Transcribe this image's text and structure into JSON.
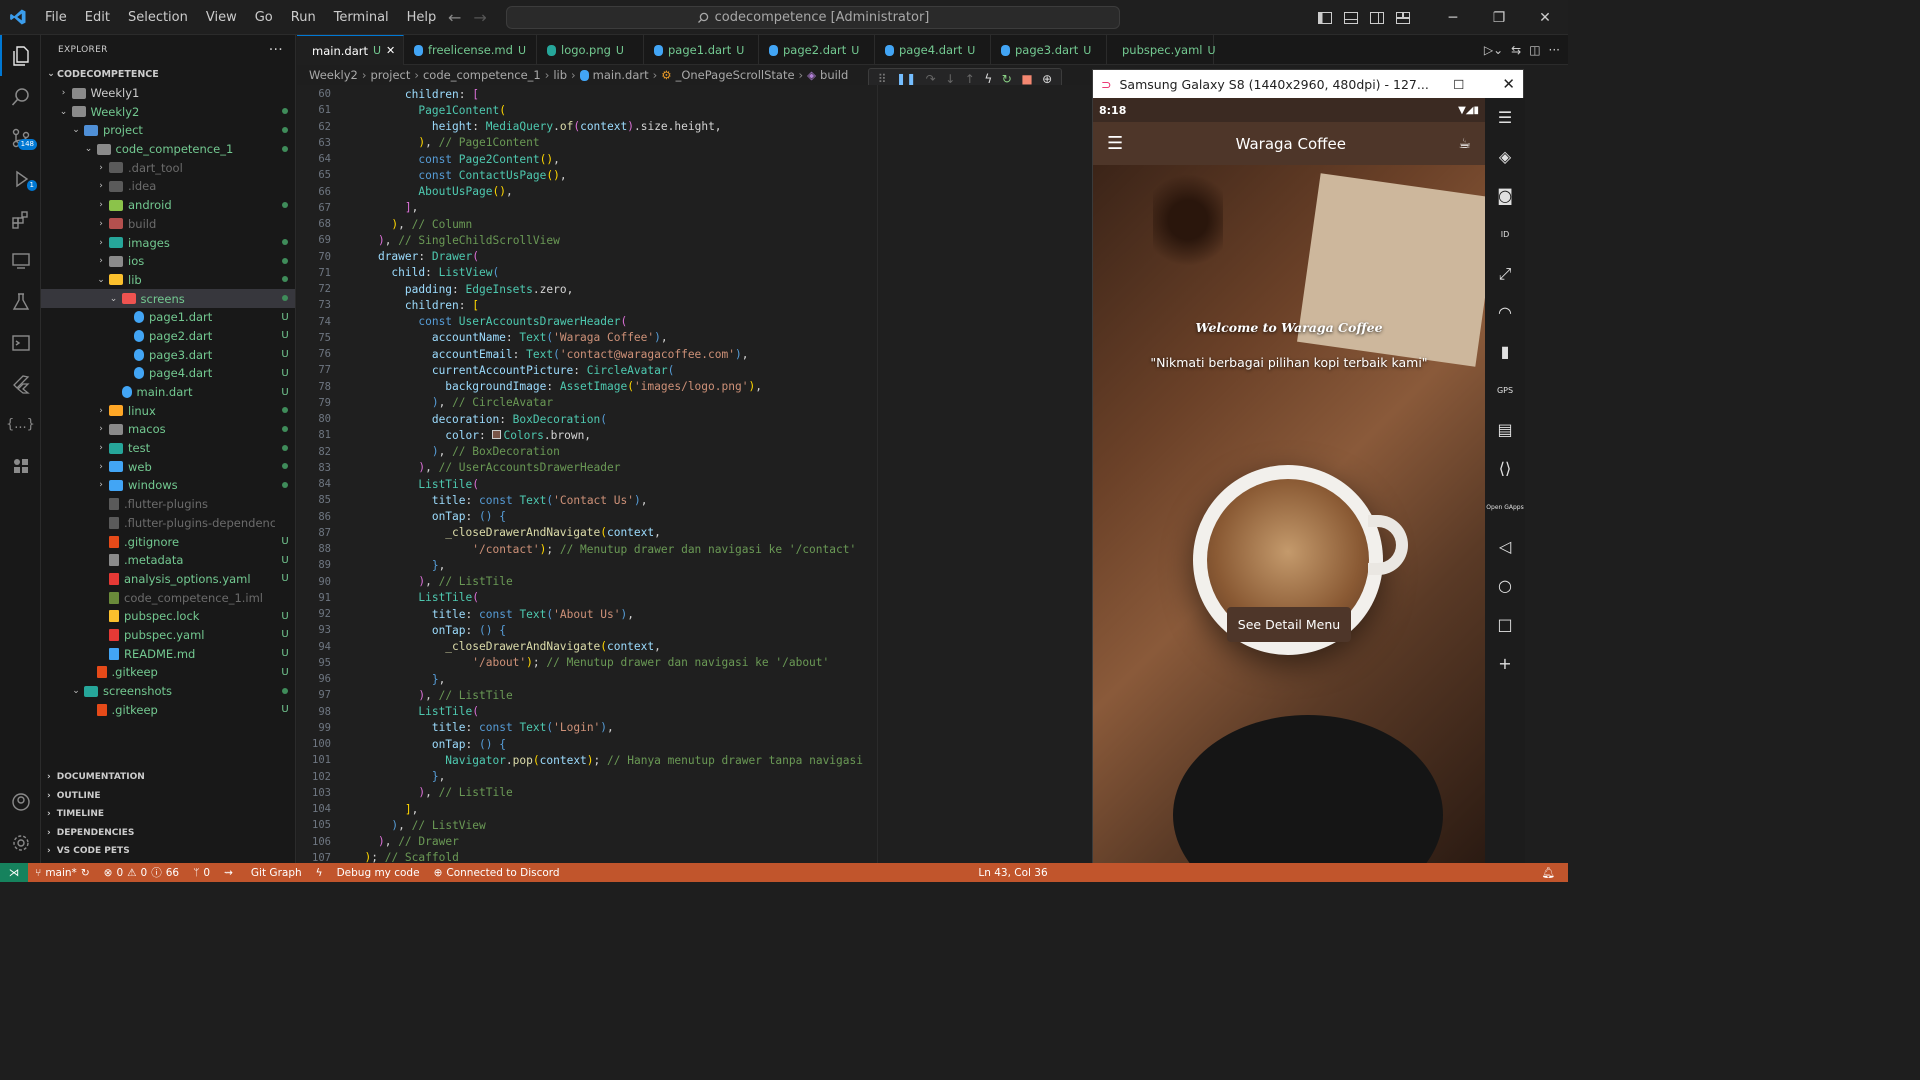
{
  "menu": [
    "File",
    "Edit",
    "Selection",
    "View",
    "Go",
    "Run",
    "Terminal",
    "Help"
  ],
  "command_center": "codecompetence [Administrator]",
  "explorer": {
    "title": "EXPLORER",
    "root": "CODECOMPETENCE",
    "items": [
      {
        "label": "Weekly1",
        "depth": 1,
        "kind": "folder",
        "open": false,
        "status": "",
        "dim": false,
        "color": "#8a8a8a"
      },
      {
        "label": "Weekly2",
        "depth": 1,
        "kind": "folder",
        "open": true,
        "status": "dot",
        "dim": false,
        "color": "#8a8a8a"
      },
      {
        "label": "project",
        "depth": 2,
        "kind": "folder",
        "open": true,
        "status": "dot",
        "dim": false,
        "color": "#4f8fd6"
      },
      {
        "label": "code_competence_1",
        "depth": 3,
        "kind": "folder",
        "open": true,
        "status": "dot",
        "dim": false,
        "color": "#8a8a8a"
      },
      {
        "label": ".dart_tool",
        "depth": 4,
        "kind": "folder",
        "open": false,
        "status": "",
        "dim": true,
        "color": "#5a5a5a"
      },
      {
        "label": ".idea",
        "depth": 4,
        "kind": "folder",
        "open": false,
        "status": "",
        "dim": true,
        "color": "#5a5a5a"
      },
      {
        "label": "android",
        "depth": 4,
        "kind": "folder",
        "open": false,
        "status": "dot",
        "dim": false,
        "color": "#8bc34a"
      },
      {
        "label": "build",
        "depth": 4,
        "kind": "folder",
        "open": false,
        "status": "",
        "dim": true,
        "color": "#b4504e"
      },
      {
        "label": "images",
        "depth": 4,
        "kind": "folder",
        "open": false,
        "status": "dot",
        "dim": false,
        "color": "#26a69a"
      },
      {
        "label": "ios",
        "depth": 4,
        "kind": "folder",
        "open": false,
        "status": "dot",
        "dim": false,
        "color": "#8a8a8a"
      },
      {
        "label": "lib",
        "depth": 4,
        "kind": "folder",
        "open": true,
        "status": "dot",
        "dim": false,
        "color": "#fbc02d"
      },
      {
        "label": "screens",
        "depth": 5,
        "kind": "folder",
        "open": true,
        "status": "dot",
        "dim": false,
        "color": "#ef5350",
        "selected": true
      },
      {
        "label": "page1.dart",
        "depth": 6,
        "kind": "dart",
        "status": "U",
        "dim": false,
        "color": "#42a5f5"
      },
      {
        "label": "page2.dart",
        "depth": 6,
        "kind": "dart",
        "status": "U",
        "dim": false,
        "color": "#42a5f5"
      },
      {
        "label": "page3.dart",
        "depth": 6,
        "kind": "dart",
        "status": "U",
        "dim": false,
        "color": "#42a5f5"
      },
      {
        "label": "page4.dart",
        "depth": 6,
        "kind": "dart",
        "status": "U",
        "dim": false,
        "color": "#42a5f5"
      },
      {
        "label": "main.dart",
        "depth": 5,
        "kind": "dart",
        "status": "U",
        "dim": false,
        "color": "#42a5f5"
      },
      {
        "label": "linux",
        "depth": 4,
        "kind": "folder",
        "open": false,
        "status": "dot",
        "dim": false,
        "color": "#ffa726"
      },
      {
        "label": "macos",
        "depth": 4,
        "kind": "folder",
        "open": false,
        "status": "dot",
        "dim": false,
        "color": "#8a8a8a"
      },
      {
        "label": "test",
        "depth": 4,
        "kind": "folder",
        "open": false,
        "status": "dot",
        "dim": false,
        "color": "#26a69a"
      },
      {
        "label": "web",
        "depth": 4,
        "kind": "folder",
        "open": false,
        "status": "dot",
        "dim": false,
        "color": "#42a5f5"
      },
      {
        "label": "windows",
        "depth": 4,
        "kind": "folder",
        "open": false,
        "status": "dot",
        "dim": false,
        "color": "#42a5f5"
      },
      {
        "label": ".flutter-plugins",
        "depth": 4,
        "kind": "file",
        "status": "",
        "dim": true,
        "color": "#5a5a5a"
      },
      {
        "label": ".flutter-plugins-dependencies",
        "depth": 4,
        "kind": "file",
        "status": "",
        "dim": true,
        "color": "#5a5a5a"
      },
      {
        "label": ".gitignore",
        "depth": 4,
        "kind": "git",
        "status": "U",
        "dim": false,
        "color": "#e64a19"
      },
      {
        "label": ".metadata",
        "depth": 4,
        "kind": "file",
        "status": "U",
        "dim": false,
        "color": "#8a8a8a"
      },
      {
        "label": "analysis_options.yaml",
        "depth": 4,
        "kind": "yaml",
        "status": "U",
        "dim": false,
        "color": "#e53935"
      },
      {
        "label": "code_competence_1.iml",
        "depth": 4,
        "kind": "file",
        "status": "",
        "dim": true,
        "color": "#6a8a3a"
      },
      {
        "label": "pubspec.lock",
        "depth": 4,
        "kind": "lock",
        "status": "U",
        "dim": false,
        "color": "#fbc02d"
      },
      {
        "label": "pubspec.yaml",
        "depth": 4,
        "kind": "yaml",
        "status": "U",
        "dim": false,
        "color": "#e53935"
      },
      {
        "label": "README.md",
        "depth": 4,
        "kind": "info",
        "status": "U",
        "dim": false,
        "color": "#42a5f5"
      },
      {
        "label": ".gitkeep",
        "depth": 3,
        "kind": "git",
        "status": "U",
        "dim": false,
        "color": "#e64a19"
      },
      {
        "label": "screenshots",
        "depth": 2,
        "kind": "folder",
        "open": true,
        "status": "dot",
        "dim": false,
        "color": "#26a69a"
      },
      {
        "label": ".gitkeep",
        "depth": 3,
        "kind": "git",
        "status": "U",
        "dim": false,
        "color": "#e64a19"
      }
    ],
    "sections": [
      "DOCUMENTATION",
      "OUTLINE",
      "TIMELINE",
      "DEPENDENCIES",
      "VS CODE PETS"
    ]
  },
  "tabs": [
    {
      "label": "main.dart",
      "status": "U",
      "active": true,
      "icon_color": "#42a5f5",
      "width": 107
    },
    {
      "label": "freelicense.md",
      "status": "U",
      "active": false,
      "icon_color": "#42a5f5",
      "width": 133
    },
    {
      "label": "logo.png",
      "status": "U",
      "active": false,
      "icon_color": "#26a69a",
      "width": 107
    },
    {
      "label": "page1.dart",
      "status": "U",
      "active": false,
      "icon_color": "#42a5f5",
      "width": 115
    },
    {
      "label": "page2.dart",
      "status": "U",
      "active": false,
      "icon_color": "#42a5f5",
      "width": 116
    },
    {
      "label": "page4.dart",
      "status": "U",
      "active": false,
      "icon_color": "#42a5f5",
      "width": 116
    },
    {
      "label": "page3.dart",
      "status": "U",
      "active": false,
      "icon_color": "#42a5f5",
      "width": 116
    },
    {
      "label": "pubspec.yaml",
      "status": "U",
      "active": false,
      "icon_color": "#e53935",
      "width": 107
    }
  ],
  "breadcrumb": [
    "Weekly2",
    "project",
    "code_competence_1",
    "lib",
    "main.dart",
    "_OnePageScrollState",
    "build"
  ],
  "code": [
    {
      "n": "60",
      "html": "<span class=\"w\">        </span><span class=\"p\">children</span><span class=\"w\">: </span><span class=\"m\">[</span>"
    },
    {
      "n": "61",
      "html": "<span class=\"w\">          </span><span class=\"t\">Page1Content</span><span class=\"b\">(</span>"
    },
    {
      "n": "62",
      "html": "<span class=\"w\">            </span><span class=\"p\">height</span><span class=\"w\">: </span><span class=\"t\">MediaQuery</span><span class=\"w\">.</span><span class=\"f\">of</span><span class=\"m\">(</span><span class=\"p\">context</span><span class=\"m\">)</span><span class=\"w\">.size.height,</span>"
    },
    {
      "n": "63",
      "html": "<span class=\"w\">          </span><span class=\"b\">)</span><span class=\"w\">, </span><span class=\"c\">// Page1Content</span>"
    },
    {
      "n": "64",
      "html": "<span class=\"w\">          </span><span class=\"k\">const</span><span class=\"w\"> </span><span class=\"t\">Page2Content</span><span class=\"b\">()</span><span class=\"w\">,</span>"
    },
    {
      "n": "65",
      "html": "<span class=\"w\">          </span><span class=\"k\">const</span><span class=\"w\"> </span><span class=\"t\">ContactUsPage</span><span class=\"b\">()</span><span class=\"w\">,</span>"
    },
    {
      "n": "66",
      "html": "<span class=\"w\">          </span><span class=\"t\">AboutUsPage</span><span class=\"b\">()</span><span class=\"w\">,</span>"
    },
    {
      "n": "67",
      "html": "<span class=\"w\">        </span><span class=\"m\">]</span><span class=\"w\">,</span>"
    },
    {
      "n": "68",
      "html": "<span class=\"w\">      </span><span class=\"b\">)</span><span class=\"w\">, </span><span class=\"c\">// Column</span>"
    },
    {
      "n": "69",
      "html": "<span class=\"w\">    </span><span class=\"m\">)</span><span class=\"w\">, </span><span class=\"c\">// SingleChildScrollView</span>"
    },
    {
      "n": "70",
      "html": "<span class=\"w\">    </span><span class=\"p\">drawer</span><span class=\"w\">: </span><span class=\"t\">Drawer</span><span class=\"m\">(</span>"
    },
    {
      "n": "71",
      "html": "<span class=\"w\">      </span><span class=\"p\">child</span><span class=\"w\">: </span><span class=\"t\">ListView</span><span class=\"k\">(</span>"
    },
    {
      "n": "72",
      "html": "<span class=\"w\">        </span><span class=\"p\">padding</span><span class=\"w\">: </span><span class=\"t\">EdgeInsets</span><span class=\"w\">.zero,</span>"
    },
    {
      "n": "73",
      "html": "<span class=\"w\">        </span><span class=\"p\">children</span><span class=\"w\">: </span><span class=\"b\">[</span>"
    },
    {
      "n": "74",
      "html": "<span class=\"w\">          </span><span class=\"k\">const</span><span class=\"w\"> </span><span class=\"t\">UserAccountsDrawerHeader</span><span class=\"m\">(</span>"
    },
    {
      "n": "75",
      "html": "<span class=\"w\">            </span><span class=\"p\">accountName</span><span class=\"w\">: </span><span class=\"t\">Text</span><span class=\"k\">(</span><span class=\"s\">'Waraga Coffee'</span><span class=\"k\">)</span><span class=\"w\">,</span>"
    },
    {
      "n": "76",
      "html": "<span class=\"w\">            </span><span class=\"p\">accountEmail</span><span class=\"w\">: </span><span class=\"t\">Text</span><span class=\"k\">(</span><span class=\"s\">'contact@waragacoffee.com'</span><span class=\"k\">)</span><span class=\"w\">,</span>"
    },
    {
      "n": "77",
      "html": "<span class=\"w\">            </span><span class=\"p\">currentAccountPicture</span><span class=\"w\">: </span><span class=\"t\">CircleAvatar</span><span class=\"k\">(</span>"
    },
    {
      "n": "78",
      "html": "<span class=\"w\">              </span><span class=\"p\">backgroundImage</span><span class=\"w\">: </span><span class=\"t\">AssetImage</span><span class=\"b\">(</span><span class=\"s\">'images/logo.png'</span><span class=\"b\">)</span><span class=\"w\">,</span>"
    },
    {
      "n": "79",
      "html": "<span class=\"w\">            </span><span class=\"k\">)</span><span class=\"w\">, </span><span class=\"c\">// CircleAvatar</span>"
    },
    {
      "n": "80",
      "html": "<span class=\"w\">            </span><span class=\"p\">decoration</span><span class=\"w\">: </span><span class=\"t\">BoxDecoration</span><span class=\"k\">(</span>"
    },
    {
      "n": "81",
      "html": "<span class=\"w\">              </span><span class=\"p\">color</span><span class=\"w\">: </span><span style=\"display:inline-block;width:9px;height:9px;background:#795548;border:1px solid #ccc;margin-right:2px\"></span><span class=\"t\">Colors</span><span class=\"w\">.brown,</span>"
    },
    {
      "n": "82",
      "html": "<span class=\"w\">            </span><span class=\"k\">)</span><span class=\"w\">, </span><span class=\"c\">// BoxDecoration</span>"
    },
    {
      "n": "83",
      "html": "<span class=\"w\">          </span><span class=\"m\">)</span><span class=\"w\">, </span><span class=\"c\">// UserAccountsDrawerHeader</span>"
    },
    {
      "n": "84",
      "html": "<span class=\"w\">          </span><span class=\"t\">ListTile</span><span class=\"m\">(</span>"
    },
    {
      "n": "85",
      "html": "<span class=\"w\">            </span><span class=\"p\">title</span><span class=\"w\">: </span><span class=\"k\">const</span><span class=\"w\"> </span><span class=\"t\">Text</span><span class=\"k\">(</span><span class=\"s\">'Contact Us'</span><span class=\"k\">)</span><span class=\"w\">,</span>"
    },
    {
      "n": "86",
      "html": "<span class=\"w\">            </span><span class=\"p\">onTap</span><span class=\"w\">: </span><span class=\"k\">()</span><span class=\"w\"> </span><span class=\"k\">{</span>"
    },
    {
      "n": "87",
      "html": "<span class=\"w\">              </span><span class=\"f\">_closeDrawerAndNavigate</span><span class=\"b\">(</span><span class=\"p\">context</span><span class=\"w\">,</span>"
    },
    {
      "n": "88",
      "html": "<span class=\"w\">                  </span><span class=\"s\">'/contact'</span><span class=\"b\">)</span><span class=\"w\">; </span><span class=\"c\">// Menutup drawer dan navigasi ke '/contact'</span>"
    },
    {
      "n": "89",
      "html": "<span class=\"w\">            </span><span class=\"k\">}</span><span class=\"w\">,</span>"
    },
    {
      "n": "90",
      "html": "<span class=\"w\">          </span><span class=\"m\">)</span><span class=\"w\">, </span><span class=\"c\">// ListTile</span>"
    },
    {
      "n": "91",
      "html": "<span class=\"w\">          </span><span class=\"t\">ListTile</span><span class=\"m\">(</span>"
    },
    {
      "n": "92",
      "html": "<span class=\"w\">            </span><span class=\"p\">title</span><span class=\"w\">: </span><span class=\"k\">const</span><span class=\"w\"> </span><span class=\"t\">Text</span><span class=\"k\">(</span><span class=\"s\">'About Us'</span><span class=\"k\">)</span><span class=\"w\">,</span>"
    },
    {
      "n": "93",
      "html": "<span class=\"w\">            </span><span class=\"p\">onTap</span><span class=\"w\">: </span><span class=\"k\">()</span><span class=\"w\"> </span><span class=\"k\">{</span>"
    },
    {
      "n": "94",
      "html": "<span class=\"w\">              </span><span class=\"f\">_closeDrawerAndNavigate</span><span class=\"b\">(</span><span class=\"p\">context</span><span class=\"w\">,</span>"
    },
    {
      "n": "95",
      "html": "<span class=\"w\">                  </span><span class=\"s\">'/about'</span><span class=\"b\">)</span><span class=\"w\">; </span><span class=\"c\">// Menutup drawer dan navigasi ke '/about'</span>"
    },
    {
      "n": "96",
      "html": "<span class=\"w\">            </span><span class=\"k\">}</span><span class=\"w\">,</span>"
    },
    {
      "n": "97",
      "html": "<span class=\"w\">          </span><span class=\"m\">)</span><span class=\"w\">, </span><span class=\"c\">// ListTile</span>"
    },
    {
      "n": "98",
      "html": "<span class=\"w\">          </span><span class=\"t\">ListTile</span><span class=\"m\">(</span>"
    },
    {
      "n": "99",
      "html": "<span class=\"w\">            </span><span class=\"p\">title</span><span class=\"w\">: </span><span class=\"k\">const</span><span class=\"w\"> </span><span class=\"t\">Text</span><span class=\"k\">(</span><span class=\"s\">'Login'</span><span class=\"k\">)</span><span class=\"w\">,</span>"
    },
    {
      "n": "100",
      "html": "<span class=\"w\">            </span><span class=\"p\">onTap</span><span class=\"w\">: </span><span class=\"k\">()</span><span class=\"w\"> </span><span class=\"k\">{</span>"
    },
    {
      "n": "101",
      "html": "<span class=\"w\">              </span><span class=\"t\">Navigator</span><span class=\"w\">.</span><span class=\"f\">pop</span><span class=\"b\">(</span><span class=\"p\">context</span><span class=\"b\">)</span><span class=\"w\">; </span><span class=\"c\">// Hanya menutup drawer tanpa navigasi</span>"
    },
    {
      "n": "102",
      "html": "<span class=\"w\">            </span><span class=\"k\">}</span><span class=\"w\">,</span>"
    },
    {
      "n": "103",
      "html": "<span class=\"w\">          </span><span class=\"m\">)</span><span class=\"w\">, </span><span class=\"c\">// ListTile</span>"
    },
    {
      "n": "104",
      "html": "<span class=\"w\">        </span><span class=\"b\">]</span><span class=\"w\">,</span>"
    },
    {
      "n": "105",
      "html": "<span class=\"w\">      </span><span class=\"k\">)</span><span class=\"w\">, </span><span class=\"c\">// ListView</span>"
    },
    {
      "n": "106",
      "html": "<span class=\"w\">    </span><span class=\"m\">)</span><span class=\"w\">, </span><span class=\"c\">// Drawer</span>"
    },
    {
      "n": "107",
      "html": "<span class=\"w\">  </span><span class=\"b\">)</span><span class=\"w\">; </span><span class=\"c\">// Scaffold</span>"
    }
  ],
  "emulator": {
    "title": "Samsung Galaxy S8 (1440x2960, 480dpi) - 127...",
    "time": "8:18",
    "app_title": "Waraga Coffee",
    "welcome": "Welcome to Waraga Coffee",
    "tagline": "\"Nikmati berbagai pilihan kopi terbaik kami\"",
    "button": "See Detail Menu",
    "tools": [
      "menu-icon",
      "rotate-icon",
      "screenshot-icon",
      "device-id-icon",
      "fullscreen-icon",
      "cast-icon",
      "sd-card-icon",
      "gps-icon",
      "video-icon",
      "resize-icon",
      "opengapps-icon",
      "back-icon",
      "home-icon",
      "recents-icon",
      "add-icon"
    ]
  },
  "statusbar": {
    "branch": "main*",
    "problems": "0",
    "warnings": "0",
    "infos": "66",
    "ports": "0",
    "git_graph": "Git Graph",
    "debug": "Debug my code",
    "discord": "Connected to Discord",
    "cursor": "Ln 43, Col 36"
  }
}
